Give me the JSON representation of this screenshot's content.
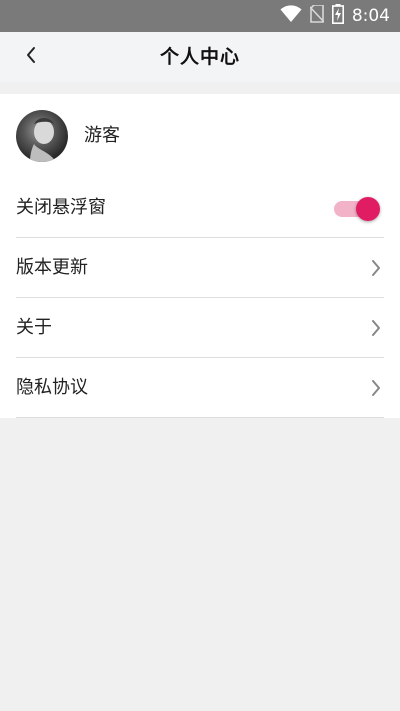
{
  "status_bar": {
    "time": "8:04",
    "icons": [
      "wifi-icon",
      "no-sim-icon",
      "battery-charging-icon"
    ]
  },
  "header": {
    "title": "个人中心",
    "back_icon": "chevron-left-icon"
  },
  "profile": {
    "username": "游客",
    "avatar": "avatar"
  },
  "settings": {
    "floating_window": {
      "label": "关闭悬浮窗",
      "enabled": true,
      "accent_color": "#e01d63",
      "track_color": "#f2b3c8"
    },
    "menu_items": [
      {
        "label": "版本更新",
        "icon": "chevron-right-icon"
      },
      {
        "label": "关于",
        "icon": "chevron-right-icon"
      },
      {
        "label": "隐私协议",
        "icon": "chevron-right-icon"
      }
    ]
  },
  "colors": {
    "status_bar": "#7a7a7a",
    "header_bg": "#f3f4f6",
    "page_bg": "#f0f0f0",
    "card_bg": "#ffffff",
    "divider": "#dddddd"
  }
}
